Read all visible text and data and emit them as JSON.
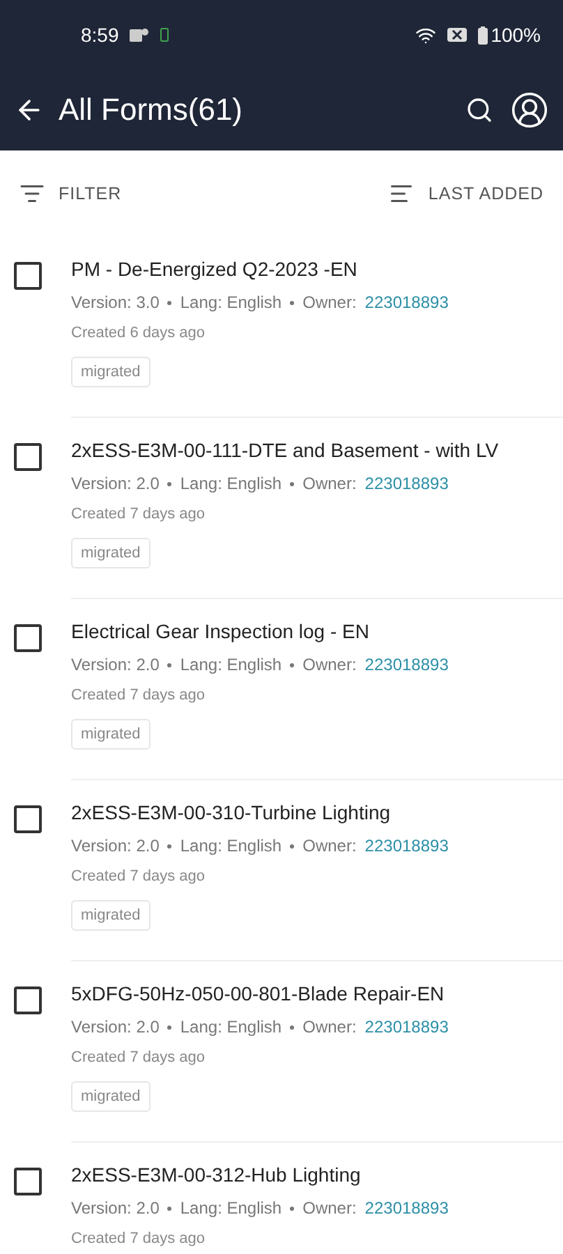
{
  "status_bar": {
    "time": "8:59",
    "battery": "100%"
  },
  "app_bar": {
    "title": "All Forms(61)"
  },
  "toolbar": {
    "filter": "FILTER",
    "sort": "LAST ADDED"
  },
  "forms": [
    {
      "title": "PM - De-Energized Q2-2023 -EN",
      "version": "Version: 3.0",
      "lang": "Lang: English",
      "owner_label": "Owner:",
      "owner": "223018893",
      "created": "Created 6 days ago",
      "tag": "migrated",
      "checked": false
    },
    {
      "title": "2xESS-E3M-00-111-DTE and Basement - with LV",
      "version": "Version: 2.0",
      "lang": "Lang: English",
      "owner_label": "Owner:",
      "owner": "223018893",
      "created": "Created 7 days ago",
      "tag": "migrated",
      "checked": false
    },
    {
      "title": "Electrical Gear Inspection log - EN",
      "version": "Version: 2.0",
      "lang": "Lang: English",
      "owner_label": "Owner:",
      "owner": "223018893",
      "created": "Created 7 days ago",
      "tag": "migrated",
      "checked": false
    },
    {
      "title": "2xESS-E3M-00-310-Turbine Lighting",
      "version": "Version: 2.0",
      "lang": "Lang: English",
      "owner_label": "Owner:",
      "owner": "223018893",
      "created": "Created 7 days ago",
      "tag": "migrated",
      "checked": false
    },
    {
      "title": "5xDFG-50Hz-050-00-801-Blade Repair-EN",
      "version": "Version: 2.0",
      "lang": "Lang: English",
      "owner_label": "Owner:",
      "owner": "223018893",
      "created": "Created 7 days ago",
      "tag": "migrated",
      "checked": false
    },
    {
      "title": "2xESS-E3M-00-312-Hub Lighting",
      "version": "Version: 2.0",
      "lang": "Lang: English",
      "owner_label": "Owner:",
      "owner": "223018893",
      "created": "Created 7 days ago",
      "checked": false
    }
  ]
}
